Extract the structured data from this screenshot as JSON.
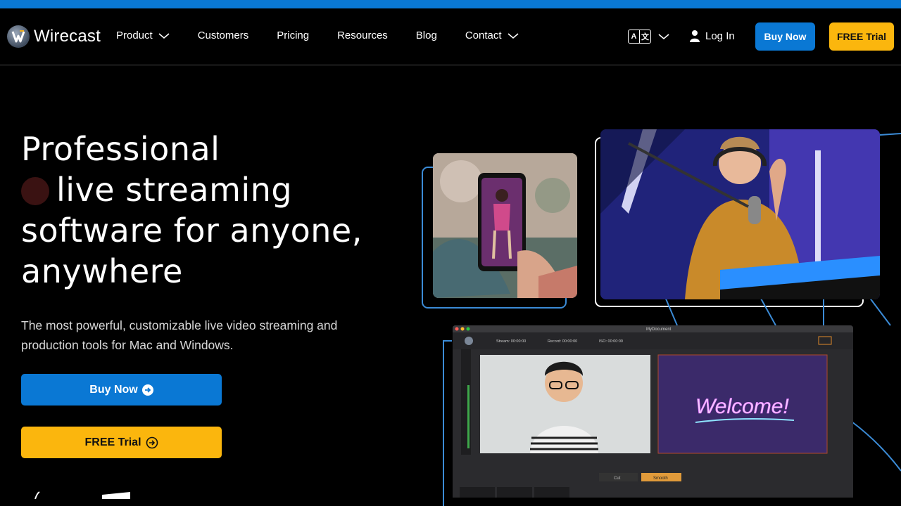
{
  "brand": {
    "name": "Wirecast"
  },
  "nav": {
    "items": [
      {
        "label": "Product",
        "has_dropdown": true
      },
      {
        "label": "Customers",
        "has_dropdown": false
      },
      {
        "label": "Pricing",
        "has_dropdown": false
      },
      {
        "label": "Resources",
        "has_dropdown": false
      },
      {
        "label": "Blog",
        "has_dropdown": false
      },
      {
        "label": "Contact",
        "has_dropdown": true
      }
    ],
    "language_icon": "translate-icon",
    "login_label": "Log In",
    "buy_label": "Buy Now",
    "trial_label": "FREE Trial"
  },
  "hero": {
    "headline_line1": "Professional",
    "headline_line2": "live streaming",
    "headline_line3": "software for anyone,",
    "headline_line4": "anywhere",
    "subtext": "The most powerful, customizable live video streaming and production tools for Mac and Windows.",
    "buy_label": "Buy Now",
    "trial_label": "FREE Trial"
  },
  "app_preview": {
    "window_title": "MyDocument",
    "stream_label": "Stream: 00:00:00",
    "record_label": "Record: 00:00:00",
    "iso_label": "ISO: 00:00:00",
    "welcome_text": "Welcome!",
    "transition_cut": "Cut",
    "transition_smooth": "Smooth"
  },
  "colors": {
    "accent_blue": "#0a78d4",
    "accent_yellow": "#fbb60d",
    "background": "#000000",
    "outline_blue": "#3b8bd6"
  }
}
